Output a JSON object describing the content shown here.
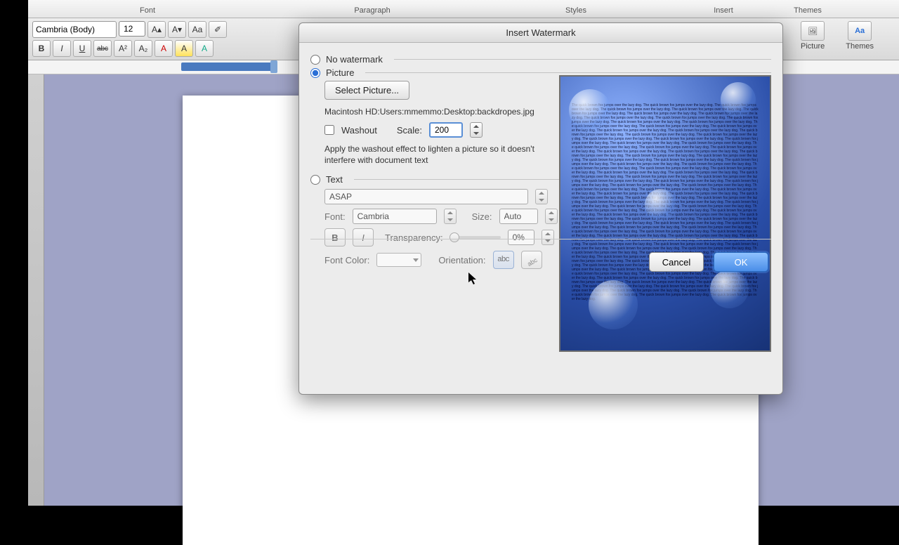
{
  "ribbon": {
    "tabs": {
      "font": "Font",
      "paragraph": "Paragraph",
      "styles": "Styles",
      "insert": "Insert",
      "themes": "Themes"
    }
  },
  "toolbar": {
    "font_name": "Cambria (Body)",
    "font_size": "12",
    "bold": "B",
    "italic": "I",
    "underline": "U",
    "strike": "abc",
    "picture_label": "Picture",
    "themes_label": "Themes"
  },
  "dialog": {
    "title": "Insert Watermark",
    "no_watermark": "No watermark",
    "picture": "Picture",
    "select_picture": "Select Picture...",
    "picture_path": "Macintosh HD:Users:mmemmo:Desktop:backdropes.jpg",
    "washout": "Washout",
    "scale_label": "Scale:",
    "scale_value": "200",
    "washout_help": "Apply the washout effect to lighten a picture so it doesn't interfere with document text",
    "text": "Text",
    "text_value": "ASAP",
    "font_label": "Font:",
    "font_value": "Cambria",
    "size_label": "Size:",
    "size_value": "Auto",
    "bold": "B",
    "italic": "I",
    "transparency_label": "Transparency:",
    "transparency_value": "0%",
    "fontcolor_label": "Font Color:",
    "orientation_label": "Orientation:",
    "orientation_h": "abc",
    "cancel": "Cancel",
    "ok": "OK",
    "selected_option": "picture"
  },
  "preview": {
    "sample_text": "The quick brown fox jumps over the lazy dog. "
  }
}
